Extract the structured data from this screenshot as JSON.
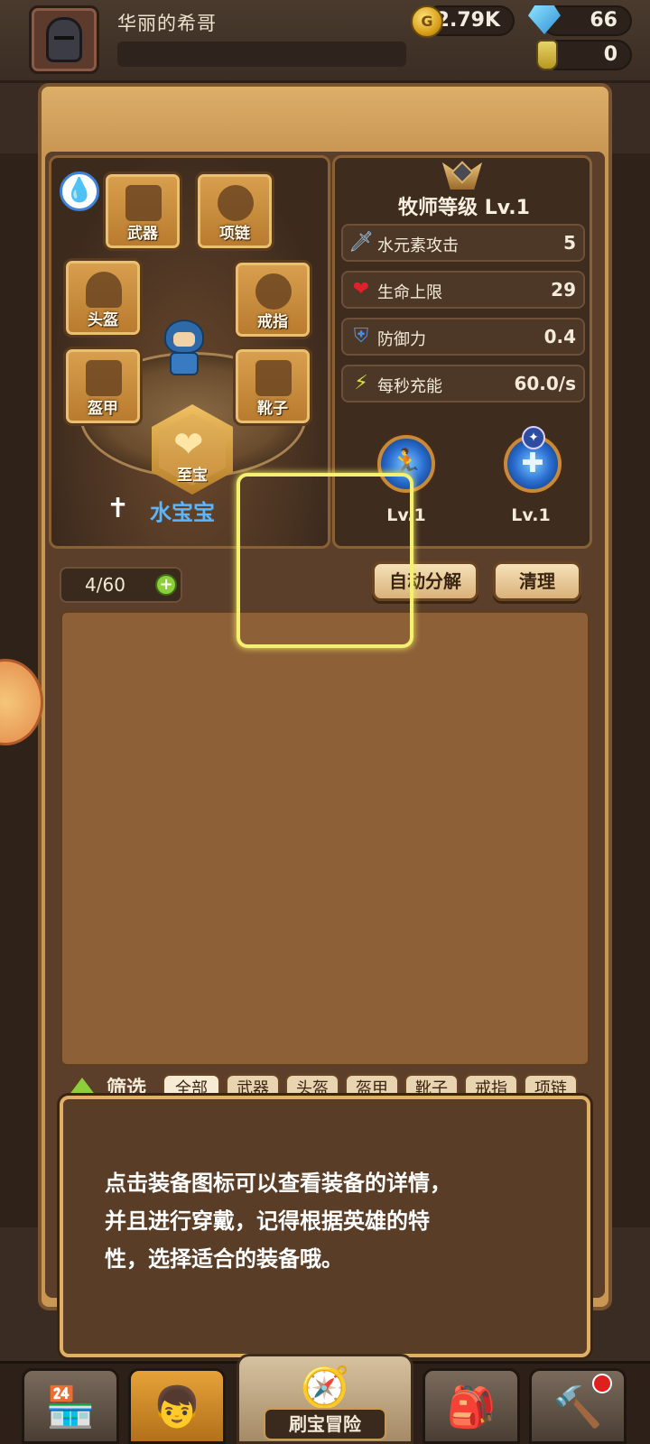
{
  "player": {
    "name": "华丽的希哥",
    "gold": "2.79K",
    "gems": "66",
    "potions": "0"
  },
  "equipment": {
    "slots": {
      "weapon": "武器",
      "necklace": "项链",
      "helmet": "头盔",
      "ring": "戒指",
      "armor": "盔甲",
      "boots": "靴子",
      "treasure": "至宝"
    },
    "hero_name": "水宝宝",
    "element_color": "#3b82d8"
  },
  "stats": {
    "class_level": "牧师等级 Lv.1",
    "rows": [
      {
        "icon": "water-blade-icon",
        "label": "水元素攻击",
        "value": "5"
      },
      {
        "icon": "heart-icon",
        "label": "生命上限",
        "value": "29"
      },
      {
        "icon": "shield-icon",
        "label": "防御力",
        "value": "0.4"
      },
      {
        "icon": "lightning-sword-icon",
        "label": "每秒充能",
        "value": "60.0/s"
      }
    ],
    "skills": [
      {
        "level": "Lv.1"
      },
      {
        "level": "Lv.1"
      }
    ]
  },
  "inventory": {
    "capacity": "4/60",
    "auto_decompose": "自动分解",
    "clean": "清理",
    "filter_label": "筛选",
    "filters": [
      "全部",
      "武器",
      "头盔",
      "盔甲",
      "靴子",
      "戒指",
      "项链"
    ]
  },
  "tutorial": {
    "line1": "点击装备图标可以查看装备的详情，",
    "line2": "并且进行穿戴，记得根据英雄的特",
    "line3": "性，选择适合的装备哦。"
  },
  "bottom_nav": {
    "center_label": "刷宝冒险"
  },
  "colors": {
    "accent_gold": "#e0b066",
    "highlight": "#f4f070",
    "hero_name": "#5ab6ff"
  }
}
